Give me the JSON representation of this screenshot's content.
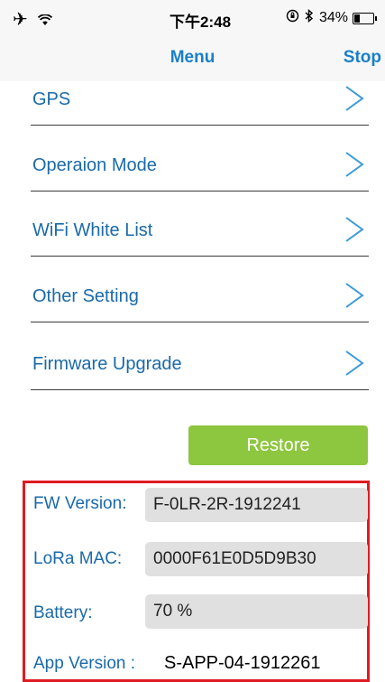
{
  "status_bar": {
    "left_icons": [
      "airplane-icon",
      "wifi-icon"
    ],
    "time": "下午2:48",
    "right_icons": [
      "rotation-lock-icon",
      "bluetooth-icon"
    ],
    "battery_percent_text": "34%",
    "battery_level": 0.34
  },
  "nav": {
    "title": "Menu",
    "right_action": "Stop"
  },
  "menu": {
    "items": [
      {
        "label": "GPS"
      },
      {
        "label": "Operaion Mode"
      },
      {
        "label": "WiFi White List"
      },
      {
        "label": "Other Setting"
      },
      {
        "label": "Firmware Upgrade"
      }
    ]
  },
  "restore_button": "Restore",
  "info": {
    "fw_version_label": "FW Version:",
    "fw_version_value": "F-0LR-2R-1912241",
    "lora_mac_label": "LoRa MAC:",
    "lora_mac_value": "0000F61E0D5D9B30",
    "battery_label": "Battery:",
    "battery_value": "70 %",
    "app_version_label": "App Version :",
    "app_version_value": "S-APP-04-1912261"
  },
  "colors": {
    "accent_blue": "#1a80c8",
    "label_blue": "#1a6aa8",
    "restore_green": "#8dc63f",
    "highlight_red": "#e01a22",
    "field_gray": "#e0e0e0"
  }
}
